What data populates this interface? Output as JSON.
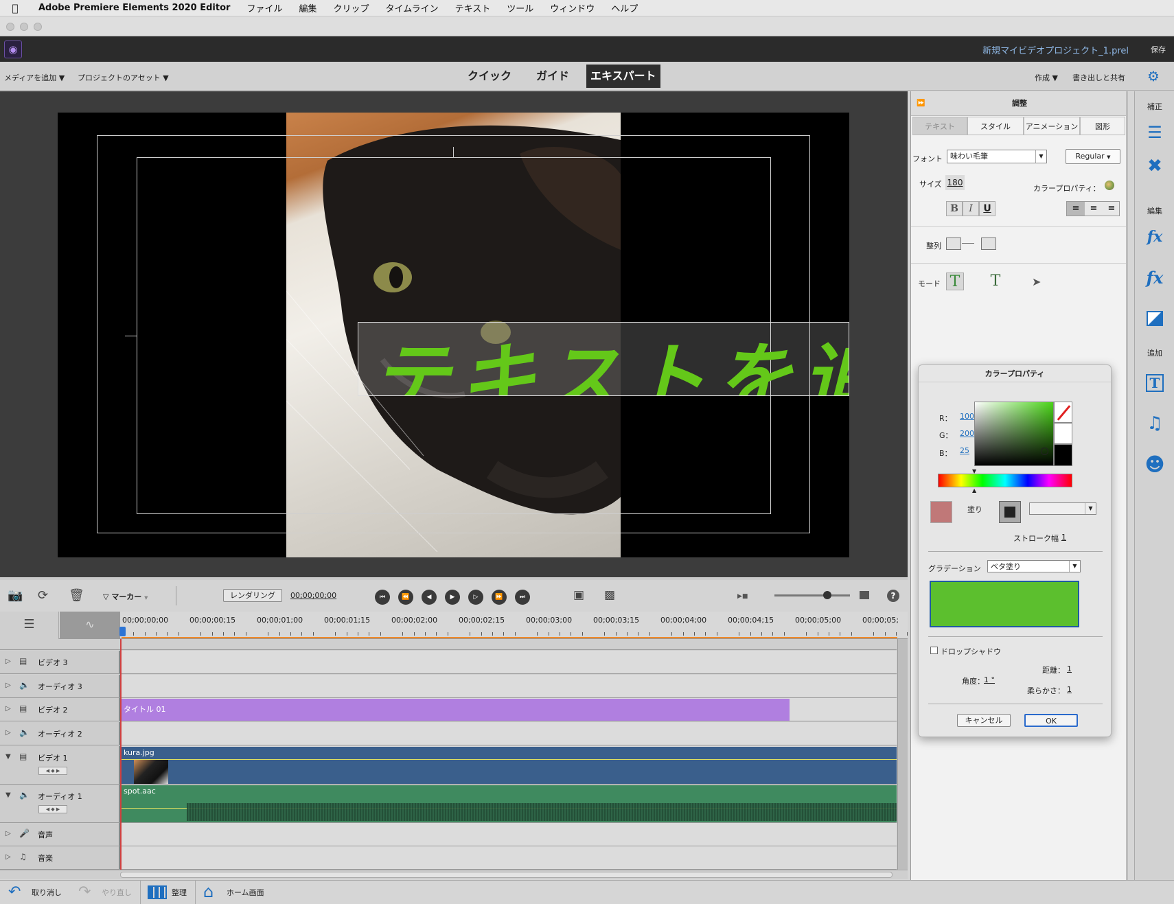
{
  "menubar": {
    "app_name": "Adobe Premiere Elements 2020 Editor",
    "items": [
      "ファイル",
      "編集",
      "クリップ",
      "タイムライン",
      "テキスト",
      "ツール",
      "ウィンドウ",
      "ヘルプ"
    ]
  },
  "header": {
    "project_name": "新規マイビデオプロジェクト_1.prel",
    "save_label": "保存"
  },
  "modebar": {
    "add_media": "メディアを追加",
    "project_assets": "プロジェクトのアセット",
    "tabs": [
      "クイック",
      "ガイド",
      "エキスパート"
    ],
    "active_tab": "エキスパート",
    "create": "作成",
    "export_share": "書き出しと共有"
  },
  "monitor": {
    "overlay_text": "テキストを追加"
  },
  "timeline_toolbar": {
    "marker_label": "マーカー",
    "render_label": "レンダリング",
    "timecode": "00;00;00;00"
  },
  "ruler": {
    "ticks": [
      "00;00;00;00",
      "00;00;00;15",
      "00;00;01;00",
      "00;00;01;15",
      "00;00;02;00",
      "00;00;02;15",
      "00;00;03;00",
      "00;00;03;15",
      "00;00;04;00",
      "00;00;04;15",
      "00;00;05;00",
      "00;00;05;"
    ]
  },
  "tracks": [
    {
      "name": "ビデオ 3",
      "kind": "video"
    },
    {
      "name": "オーディオ 3",
      "kind": "audio"
    },
    {
      "name": "ビデオ 2",
      "kind": "video",
      "clip": "タイトル 01"
    },
    {
      "name": "オーディオ 2",
      "kind": "audio"
    },
    {
      "name": "ビデオ 1",
      "kind": "video",
      "clip": "kura.jpg"
    },
    {
      "name": "オーディオ 1",
      "kind": "audio",
      "clip": "spot.aac"
    },
    {
      "name": "音声",
      "kind": "voice"
    },
    {
      "name": "音楽",
      "kind": "music"
    }
  ],
  "statusbar": {
    "undo": "取り消し",
    "redo": "やり直し",
    "organize": "整理",
    "home": "ホーム画面"
  },
  "adjust_panel": {
    "title": "調整",
    "tabs": [
      "テキスト",
      "スタイル",
      "アニメーション",
      "図形"
    ],
    "font_label": "フォント",
    "font_value": "味わい毛筆",
    "style_value": "Regular",
    "size_label": "サイズ",
    "size_value": "180",
    "color_prop_label": "カラープロパティ：",
    "bold": "B",
    "italic": "I",
    "underline": "U",
    "align_label": "整列",
    "mode_label": "モード"
  },
  "color_dialog": {
    "title": "カラープロパティ",
    "r_label": "R：",
    "r_value": "100",
    "g_label": "G：",
    "g_value": "200",
    "b_label": "B：",
    "b_value": "25",
    "fill_label": "塗り",
    "stroke_label": "ストローク幅",
    "stroke_value": "1",
    "gradient_label": "グラデーション",
    "gradient_value": "ベタ塗り",
    "drop_shadow_label": "ドロップシャドウ",
    "distance_label": "距離：",
    "distance_value": "1",
    "angle_label": "角度：",
    "angle_value": "1 °",
    "softness_label": "柔らかさ：",
    "softness_value": "1",
    "cancel": "キャンセル",
    "ok": "OK",
    "color_hex": "#64c819"
  },
  "side_toolbar": {
    "fix_label": "補正",
    "edit_label": "編集",
    "add_label": "追加"
  }
}
